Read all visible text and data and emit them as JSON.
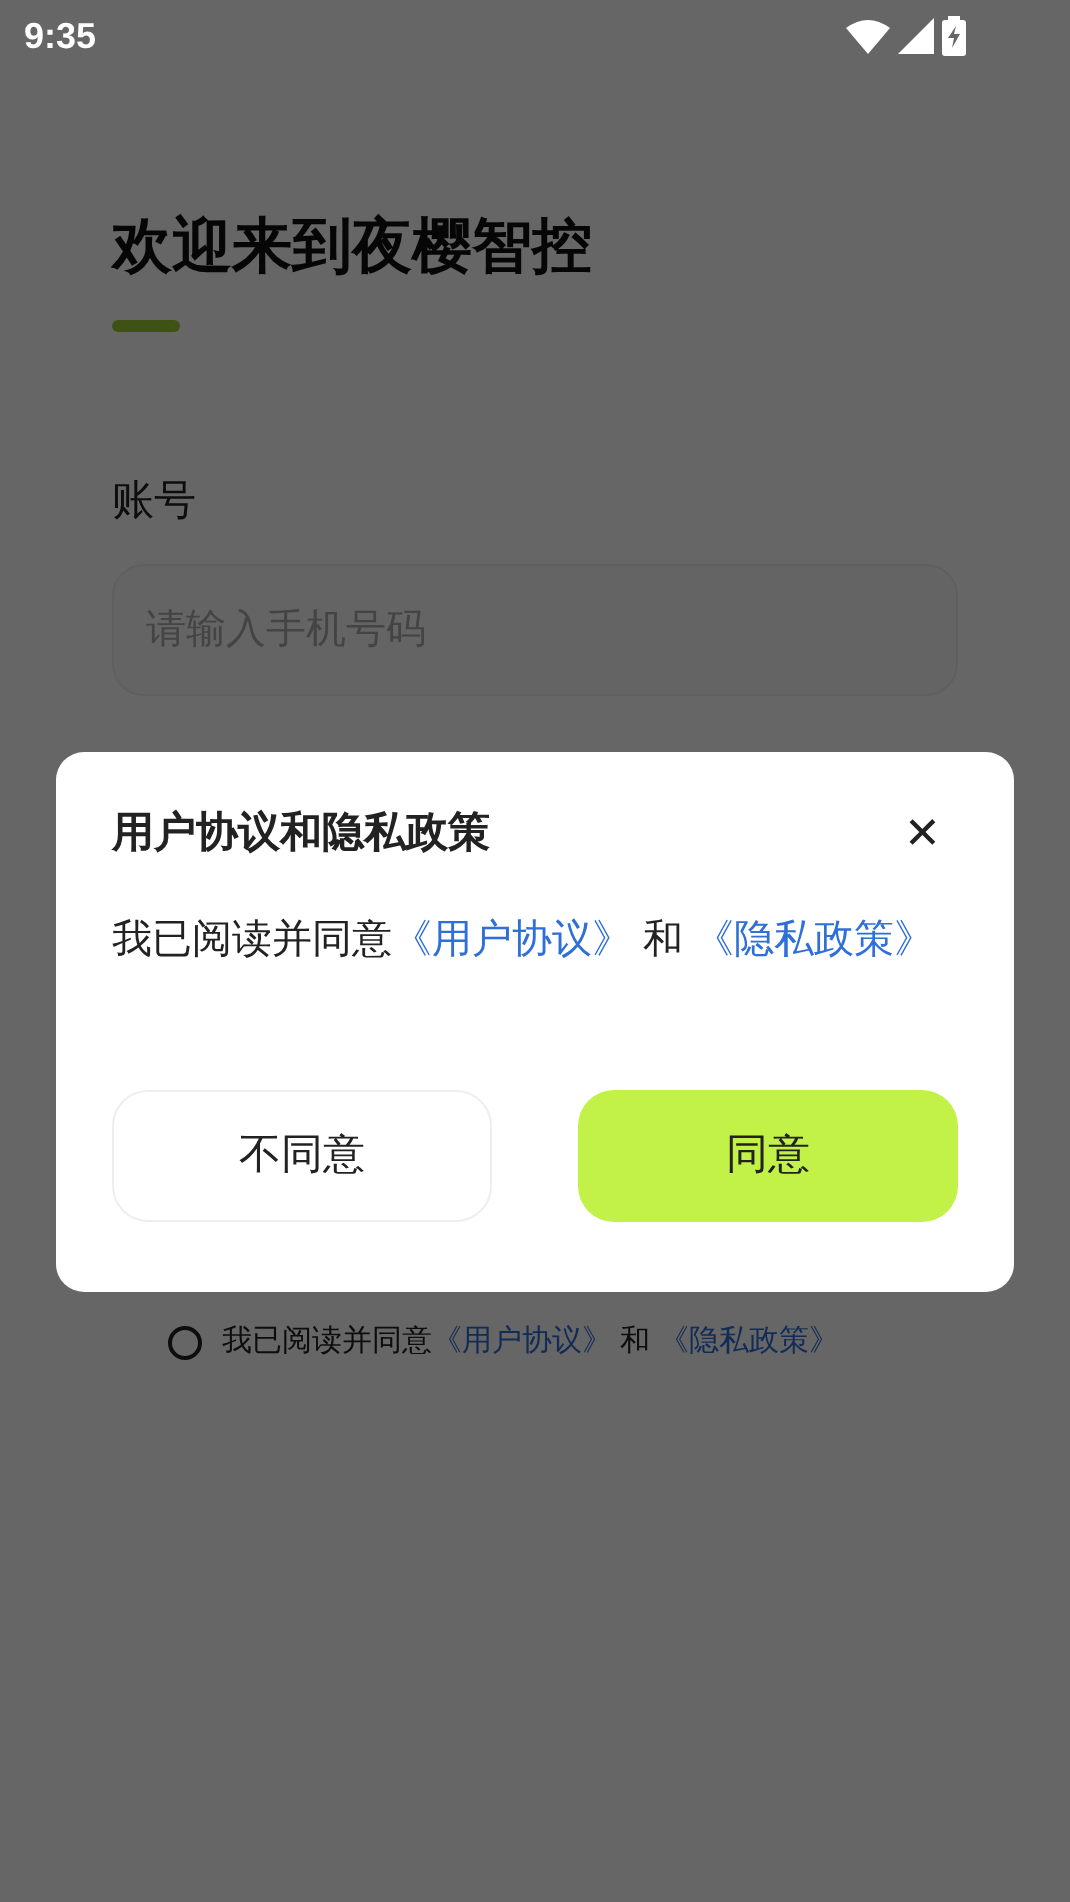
{
  "status_bar": {
    "time": "9:35"
  },
  "title": "欢迎来到夜樱智控",
  "account_label": "账号",
  "phone_field": {
    "placeholder": "请输入手机号码"
  },
  "agreement": {
    "checked": false,
    "parts": [
      {
        "kind": "text",
        "text": "我已阅读并同意"
      },
      {
        "kind": "link",
        "text": "《用户协议》"
      },
      {
        "kind": "text",
        "text": " 和 "
      },
      {
        "kind": "link",
        "text": "《隐私政策》"
      }
    ]
  },
  "dialog": {
    "title": "用户协议和隐私政策",
    "close": "✕",
    "parts": [
      {
        "kind": "text",
        "text": "我已阅读并同意"
      },
      {
        "kind": "link",
        "text": "《用户协议》"
      },
      {
        "kind": "text",
        "text": " 和 "
      },
      {
        "kind": "link",
        "text": "《隐私政策》"
      }
    ],
    "buttons": [
      {
        "label": "不同意",
        "kind": "secondary"
      },
      {
        "label": "同意",
        "kind": "primary"
      }
    ]
  }
}
